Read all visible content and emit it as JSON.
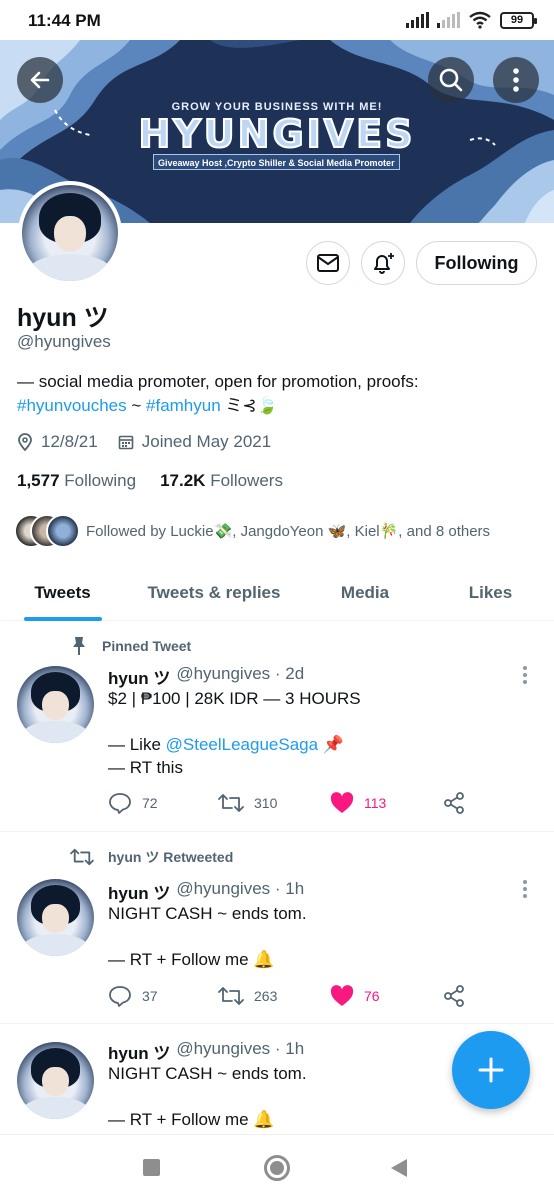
{
  "status_bar": {
    "time": "11:44 PM",
    "battery": "99"
  },
  "banner": {
    "subtitle": "GROW YOUR BUSINESS WITH ME!",
    "title": "HYUNGIVES",
    "tagline": "Giveaway Host ,Crypto Shiller & Social Media Promoter"
  },
  "profile": {
    "name": "hyun ツ",
    "handle": "@hyungives",
    "bio_text": "— social media promoter, open for promotion, proofs:",
    "bio_tag1": "#hyunvouches",
    "bio_sep": " ~ ",
    "bio_tag2": "#famhyun",
    "bio_emoji": " ミ⊰🍃",
    "location": "12/8/21",
    "joined": "Joined May 2021",
    "following_count": "1,577",
    "following_label": "Following",
    "followers_count": "17.2K",
    "followers_label": "Followers",
    "followed_by": "Followed by Luckie💸, JangdoYeon 🦋, Kiel🎋, and 8 others",
    "follow_button": "Following"
  },
  "tabs": [
    {
      "label": "Tweets",
      "active": true
    },
    {
      "label": "Tweets & replies",
      "active": false
    },
    {
      "label": "Media",
      "active": false
    },
    {
      "label": "Likes",
      "active": false
    }
  ],
  "tweets": [
    {
      "context": "Pinned Tweet",
      "context_icon": "pin-icon",
      "name": "hyun ツ",
      "handle": "@hyungives · 2d",
      "line1": "$2 | ₱100 | 28K IDR — 3 HOURS",
      "line2_prefix": "— Like ",
      "line2_link": "@SteelLeagueSaga",
      "line2_suffix": " 📌",
      "line3": "— RT this",
      "replies": "72",
      "retweets": "310",
      "likes": "113"
    },
    {
      "context": "hyun ツ Retweeted",
      "context_icon": "retweet-icon",
      "name": "hyun ツ",
      "handle": "@hyungives · 1h",
      "line1": "NIGHT CASH ~ ends tom.",
      "line3": "— RT + Follow me 🔔",
      "replies": "37",
      "retweets": "263",
      "likes": "76"
    },
    {
      "name": "hyun ツ",
      "handle": "@hyungives · 1h",
      "line1": "NIGHT CASH ~ ends tom.",
      "line3": "— RT + Follow me 🔔"
    }
  ],
  "colors": {
    "accent": "#1d9bf0",
    "like": "#f91880",
    "banner": "#1e3157"
  }
}
